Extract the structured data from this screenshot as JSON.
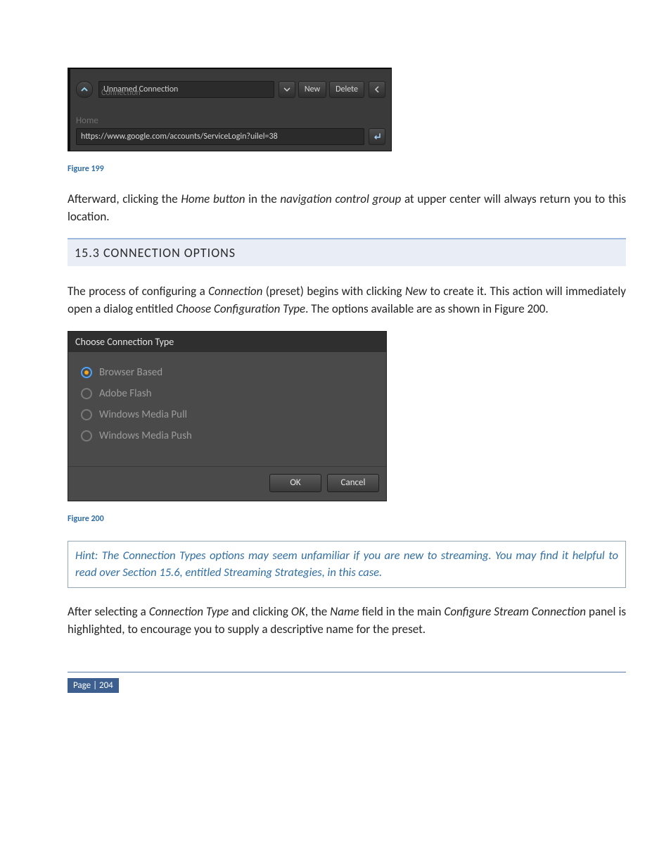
{
  "fig199": {
    "connection_label": "Connection",
    "connection_value": "Unnamed Connection",
    "new_label": "New",
    "delete_label": "Delete",
    "home_label": "Home",
    "url_value": "https://www.google.com/accounts/ServiceLogin?uilel=38"
  },
  "caption199": "Figure 199",
  "para1_parts": {
    "a": "Afterward, clicking the ",
    "b": "Home button",
    "c": " in the ",
    "d": "navigation control group",
    "e": " at upper center will always return you to this location."
  },
  "section_heading": "15.3  CONNECTION OPTIONS",
  "para2_parts": {
    "a": "The process of configuring a ",
    "b": "Connection",
    "c": " (preset) begins with clicking ",
    "d": "New",
    "e": " to create it.  This action will immediately open a dialog entitled ",
    "f": "Choose Configuration Type",
    "g": ".  The options available are as shown in Figure 200."
  },
  "fig200": {
    "title": "Choose Connection Type",
    "options": [
      {
        "label": "Browser Based",
        "selected": true
      },
      {
        "label": "Adobe Flash",
        "selected": false
      },
      {
        "label": "Windows Media Pull",
        "selected": false
      },
      {
        "label": "Windows Media Push",
        "selected": false
      }
    ],
    "ok_label": "OK",
    "cancel_label": "Cancel"
  },
  "caption200": "Figure 200",
  "hint_text": "Hint: The Connection Types options may seem unfamiliar if you are new to streaming.  You may find it helpful to read over Section 15.6, entitled Streaming Strategies, in this case.",
  "para3_parts": {
    "a": "After selecting a ",
    "b": "Connection Type",
    "c": " and clicking ",
    "d": "OK",
    "e": ", the ",
    "f": "Name",
    "g": " field in the main ",
    "h": "Configure Stream Connection",
    "i": " panel is highlighted, to encourage you to supply a descriptive name for the preset."
  },
  "footer": "Page | 204"
}
